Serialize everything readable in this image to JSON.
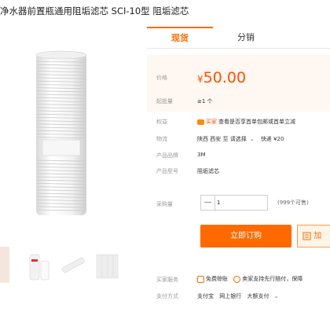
{
  "title": "净水器前置瓶通用阻垢滤芯 SCI-10型 阻垢滤芯",
  "tabs": [
    "现货",
    "分销"
  ],
  "price": {
    "label": "价格",
    "currency": "¥",
    "value": "50.00"
  },
  "moq": {
    "label": "起批量",
    "value": "≥1 个"
  },
  "rights": {
    "label": "权益",
    "tag": "买家",
    "text": "查看是否享首单包邮或首单立减"
  },
  "shipping": {
    "label": "物流",
    "origin": "陕西 西安",
    "to": "至",
    "destination": "请选择",
    "express": "快递 ¥20"
  },
  "brand": {
    "label": "产品品牌",
    "value": "3M"
  },
  "model": {
    "label": "产品型号",
    "value": "阻垢滤芯"
  },
  "quantity": {
    "label": "采购量",
    "minus": "—",
    "value": "1",
    "available": "(999个可售)"
  },
  "buttons": {
    "buy": "立即订购",
    "cart": "加"
  },
  "services": {
    "label": "买家服务",
    "items": [
      "免费赊账",
      "卖家支持先行赔付，保障"
    ]
  },
  "payment": {
    "label": "支付方式",
    "methods": [
      "支付宝",
      "网上银行",
      "大额支付"
    ],
    "more": "⌄"
  },
  "colors": {
    "accent": "#ff6a00",
    "price": "#ff5000"
  }
}
